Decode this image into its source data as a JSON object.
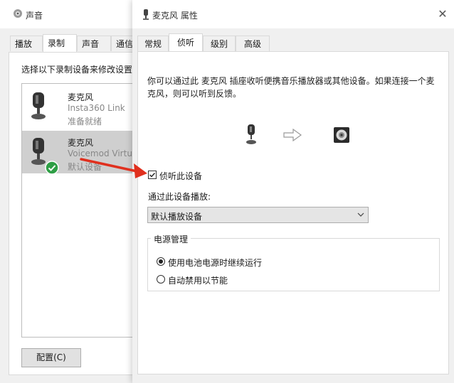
{
  "sound_window": {
    "title": "声音",
    "tabs": [
      "播放",
      "录制",
      "声音",
      "通信"
    ],
    "active_tab": "录制",
    "instruction": "选择以下录制设备来修改设置:",
    "devices": [
      {
        "name": "麦克风",
        "model": "Insta360 Link",
        "status": "准备就绪",
        "selected": false
      },
      {
        "name": "麦克风",
        "model": "Voicemod Virtu",
        "status": "默认设备",
        "selected": true
      }
    ],
    "configure_label": "配置(C)"
  },
  "properties_window": {
    "title": "麦克风 属性",
    "close_glyph": "✕",
    "tabs": [
      "常规",
      "侦听",
      "级别",
      "高级"
    ],
    "active_tab": "侦听",
    "description": "你可以通过此 麦克风 插座收听便携音乐播放器或其他设备。如果连接一个麦克风，则可以听到反馈。",
    "listen_checkbox": {
      "label": "侦听此设备",
      "checked": true
    },
    "playback_label": "通过此设备播放:",
    "playback_value": "默认播放设备",
    "power_group": {
      "legend": "电源管理",
      "options": [
        {
          "label": "使用电池电源时继续运行",
          "selected": true
        },
        {
          "label": "自动禁用以节能",
          "selected": false
        }
      ]
    }
  },
  "colors": {
    "annotation_arrow": "#e0301e",
    "default_badge": "#2e9e45",
    "selection_bg": "#cfcfcf"
  },
  "icons": [
    "speaker-icon",
    "microphone-icon",
    "arrow-right-icon",
    "speaker-output-icon",
    "checkmark-badge-icon",
    "chevron-down-icon",
    "close-icon"
  ]
}
